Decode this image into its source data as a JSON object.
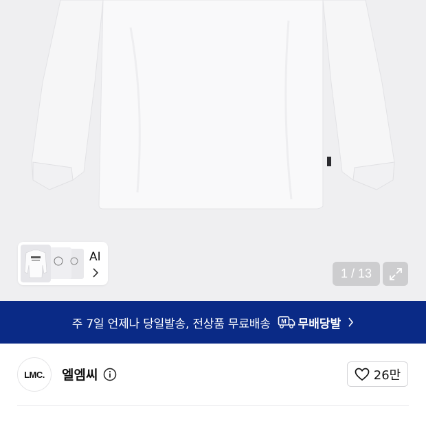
{
  "gallery": {
    "thumbnail_label": "AI",
    "page_counter": "1 / 13"
  },
  "promo_banner": {
    "text": "주 7일 언제나 당일발송, 전상품 무료배송",
    "badge_icon_letter": "M",
    "badge_label": "무배당발"
  },
  "brand": {
    "logo_text": "LMC.",
    "name": "엘엠씨"
  },
  "like": {
    "count": "26만"
  },
  "colors": {
    "banner_bg": "#0a2a86",
    "hero_bg": "#efeff1"
  },
  "icons": [
    "chevron-right-icon",
    "expand-icon",
    "delivery-truck-icon",
    "info-icon",
    "heart-icon"
  ]
}
